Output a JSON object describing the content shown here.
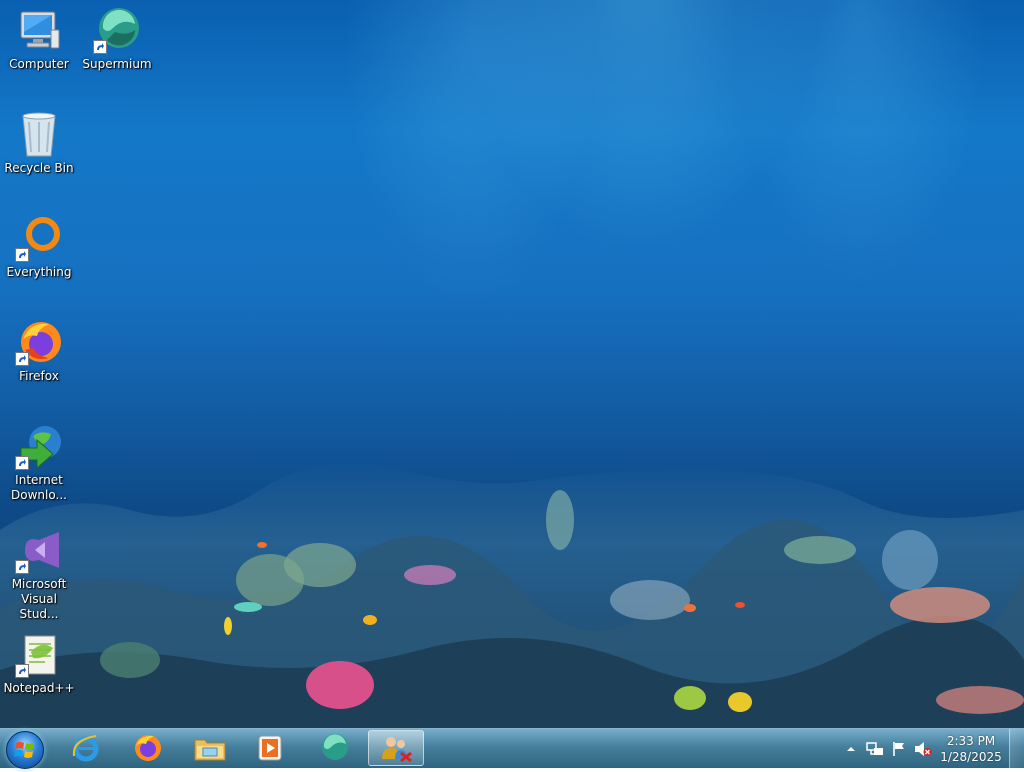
{
  "desktop": {
    "icons": [
      {
        "label": "Computer",
        "icon": "computer-icon"
      },
      {
        "label": "Supermium",
        "icon": "supermium-icon"
      },
      {
        "label": "Recycle Bin",
        "icon": "recycle-bin-icon"
      },
      {
        "label": "Everything",
        "icon": "everything-icon"
      },
      {
        "label": "Firefox",
        "icon": "firefox-icon"
      },
      {
        "label": "Internet Downlo...",
        "icon": "internet-download-manager-icon"
      },
      {
        "label": "Microsoft Visual Stud...",
        "icon": "visual-studio-icon"
      },
      {
        "label": "Notepad++",
        "icon": "notepad-plus-plus-icon"
      }
    ]
  },
  "taskbar": {
    "start_icon": "windows-start-icon",
    "pinned": [
      {
        "name": "internet-explorer",
        "icon": "internet-explorer-icon"
      },
      {
        "name": "firefox",
        "icon": "firefox-icon"
      },
      {
        "name": "file-explorer",
        "icon": "file-explorer-icon"
      },
      {
        "name": "media-player",
        "icon": "media-player-icon"
      },
      {
        "name": "supermium",
        "icon": "supermium-icon"
      },
      {
        "name": "network-connections",
        "icon": "network-connections-icon",
        "active": true
      }
    ],
    "tray": {
      "icons": [
        "show-hidden-icons-icon",
        "network-icon",
        "action-center-flag-icon",
        "volume-muted-icon"
      ]
    },
    "clock": {
      "time": "2:33 PM",
      "date": "1/28/2025"
    }
  },
  "colors": {
    "water_top": "#0a5fb0",
    "water_bottom": "#0b3c6e",
    "taskbar": "#3c7896"
  }
}
